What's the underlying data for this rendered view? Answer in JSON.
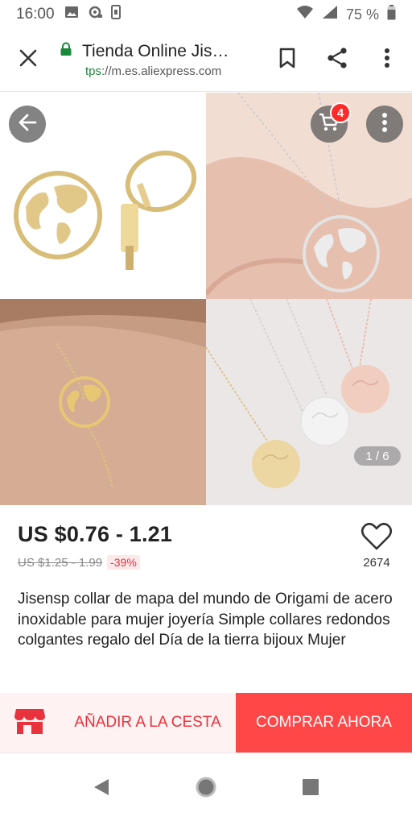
{
  "status_bar": {
    "time": "16:00",
    "battery_percent": "75 %",
    "icons": [
      "image-icon",
      "location-icon",
      "phone-icon",
      "wifi-icon",
      "signal-icon",
      "battery-icon"
    ]
  },
  "browser": {
    "tab_title": "Tienda Online Jis…",
    "url_protocol": "tps",
    "url_rest": "://m.es.aliexpress.com",
    "icons": [
      "close-icon",
      "lock-icon",
      "bookmark-icon",
      "share-icon",
      "more-vert-icon"
    ]
  },
  "gallery": {
    "cart_count": "4",
    "page_counter": "1 / 6",
    "icons": [
      "back-arrow-icon",
      "cart-icon",
      "more-vert-icon"
    ]
  },
  "product": {
    "price": "US $0.76 - 1.21",
    "original_price": "US $1.25 - 1.99",
    "discount": "-39%",
    "wishlist_count": "2674",
    "title": "Jisensp collar de mapa del mundo de Origami de acero inoxidable para mujer joyería Simple collares redondos colgantes regalo del Día de la tierra bijoux Mujer"
  },
  "actions": {
    "add_to_cart": "AÑADIR A LA CESTA",
    "buy_now": "COMPRAR AHORA",
    "accent_color": "#ff4747"
  },
  "nav": {
    "icons": [
      "back-triangle-icon",
      "home-circle-icon",
      "recents-square-icon"
    ]
  }
}
